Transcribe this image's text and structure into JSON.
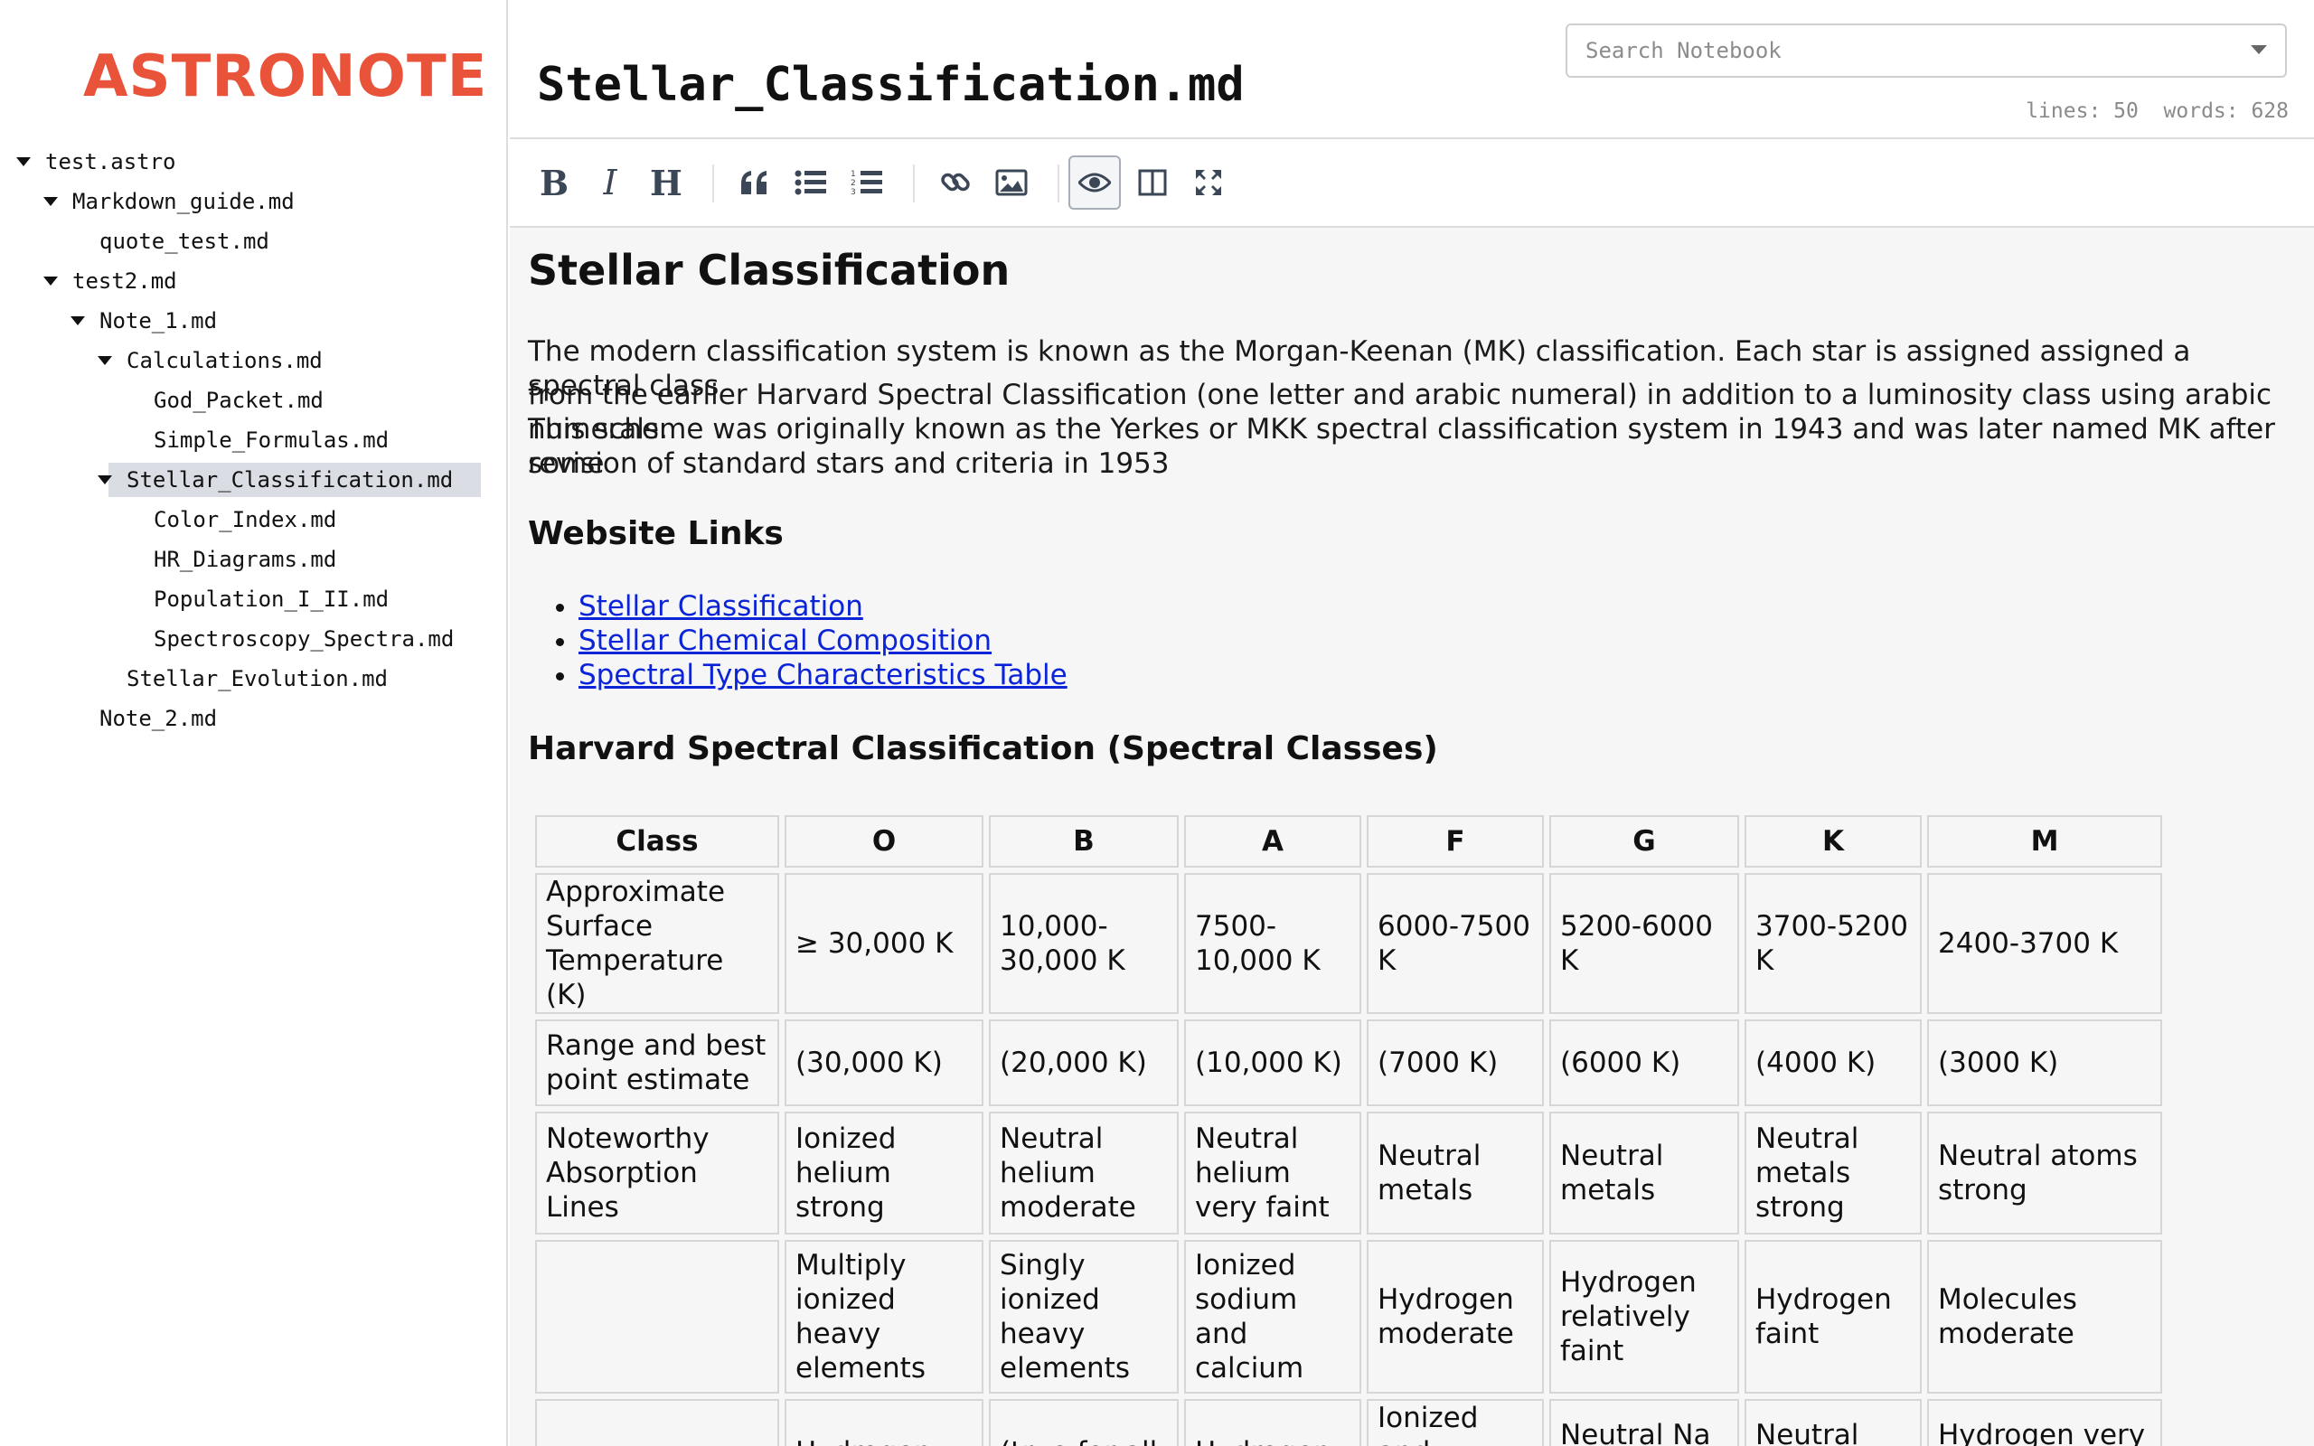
{
  "app": {
    "name": "ASTRONOTE"
  },
  "sidebar": {
    "items": [
      {
        "label": "test.astro",
        "level": 0,
        "expanded": true,
        "selected": false
      },
      {
        "label": "Markdown_guide.md",
        "level": 1,
        "expanded": true,
        "selected": false
      },
      {
        "label": "quote_test.md",
        "level": 2,
        "expanded": null,
        "selected": false
      },
      {
        "label": "test2.md",
        "level": 1,
        "expanded": true,
        "selected": false
      },
      {
        "label": "Note_1.md",
        "level": 2,
        "expanded": true,
        "selected": false
      },
      {
        "label": "Calculations.md",
        "level": 3,
        "expanded": true,
        "selected": false
      },
      {
        "label": "God_Packet.md",
        "level": 4,
        "expanded": null,
        "selected": false
      },
      {
        "label": "Simple_Formulas.md",
        "level": 4,
        "expanded": null,
        "selected": false
      },
      {
        "label": "Stellar_Classification.md",
        "level": 3,
        "expanded": true,
        "selected": true
      },
      {
        "label": "Color_Index.md",
        "level": 4,
        "expanded": null,
        "selected": false
      },
      {
        "label": "HR_Diagrams.md",
        "level": 4,
        "expanded": null,
        "selected": false
      },
      {
        "label": "Population_I_II.md",
        "level": 4,
        "expanded": null,
        "selected": false
      },
      {
        "label": "Spectroscopy_Spectra.md",
        "level": 4,
        "expanded": null,
        "selected": false
      },
      {
        "label": "Stellar_Evolution.md",
        "level": 3,
        "expanded": null,
        "selected": false
      },
      {
        "label": "Note_2.md",
        "level": 2,
        "expanded": null,
        "selected": false
      }
    ]
  },
  "header": {
    "title": "Stellar_Classification.md",
    "search_placeholder": "Search Notebook",
    "stats": "lines: 50  words: 628"
  },
  "toolbar": {
    "buttons": [
      {
        "name": "bold-button",
        "icon": "bold-icon"
      },
      {
        "name": "italic-button",
        "icon": "italic-icon"
      },
      {
        "name": "heading-button",
        "icon": "heading-icon"
      },
      {
        "name": "quote-button",
        "icon": "quote-icon"
      },
      {
        "name": "unordered-list-button",
        "icon": "list-icon"
      },
      {
        "name": "ordered-list-button",
        "icon": "ordered-list-icon"
      },
      {
        "name": "link-button",
        "icon": "link-icon"
      },
      {
        "name": "image-button",
        "icon": "image-icon"
      },
      {
        "name": "preview-button",
        "icon": "eye-icon",
        "active": true
      },
      {
        "name": "side-by-side-button",
        "icon": "columns-icon"
      },
      {
        "name": "fullscreen-button",
        "icon": "fullscreen-icon"
      }
    ]
  },
  "doc": {
    "h1": "Stellar Classification",
    "intro_lines": [
      "The modern classification system is known as the Morgan-Keenan (MK) classification. Each star is assigned assigned a spectral class",
      "from the earlier Harvard Spectral Classification (one letter and arabic numeral) in addition to a luminosity class using arabic numerals.",
      "This scheme was originally known as the Yerkes or MKK spectral classification system in 1943 and was later named MK after some",
      "revision of standard stars and criteria in 1953"
    ],
    "links_heading": "Website Links",
    "links": [
      "Stellar Classification",
      "Stellar Chemical Composition",
      "Spectral Type Characteristics Table"
    ],
    "table_heading": "Harvard Spectral Classification (Spectral Classes)",
    "table": {
      "headers": [
        "Class",
        "O",
        "B",
        "A",
        "F",
        "G",
        "K",
        "M"
      ],
      "rows": [
        [
          "Approximate Surface Temperature (K)",
          "≥ 30,000 K",
          "10,000-30,000 K",
          "7500-10,000 K",
          "6000-7500 K",
          "5200-6000 K",
          "3700-5200 K",
          "2400-3700 K"
        ],
        [
          "Range and best point estimate",
          "(30,000 K)",
          "(20,000 K)",
          "(10,000 K)",
          "(7000 K)",
          "(6000 K)",
          "(4000 K)",
          "(3000 K)"
        ],
        [
          "Noteworthy Absorption Lines",
          "Ionized helium strong",
          "Neutral helium moderate",
          "Neutral helium very faint",
          "Neutral metals",
          "Neutral metals",
          "Neutral metals strong",
          "Neutral atoms strong"
        ],
        [
          "",
          "Multiply ionized heavy elements",
          "Singly ionized heavy elements",
          "Ionized sodium and calcium",
          "Hydrogen moderate",
          "Hydrogen relatively faint",
          "Hydrogen faint",
          "Molecules moderate"
        ],
        [
          "",
          "Hydrogen",
          "(true for all",
          "Hydrogen",
          "Ionized and neutral Na",
          "Neutral Na &",
          "Neutral Ca,",
          "Hydrogen very faint"
        ]
      ]
    }
  }
}
